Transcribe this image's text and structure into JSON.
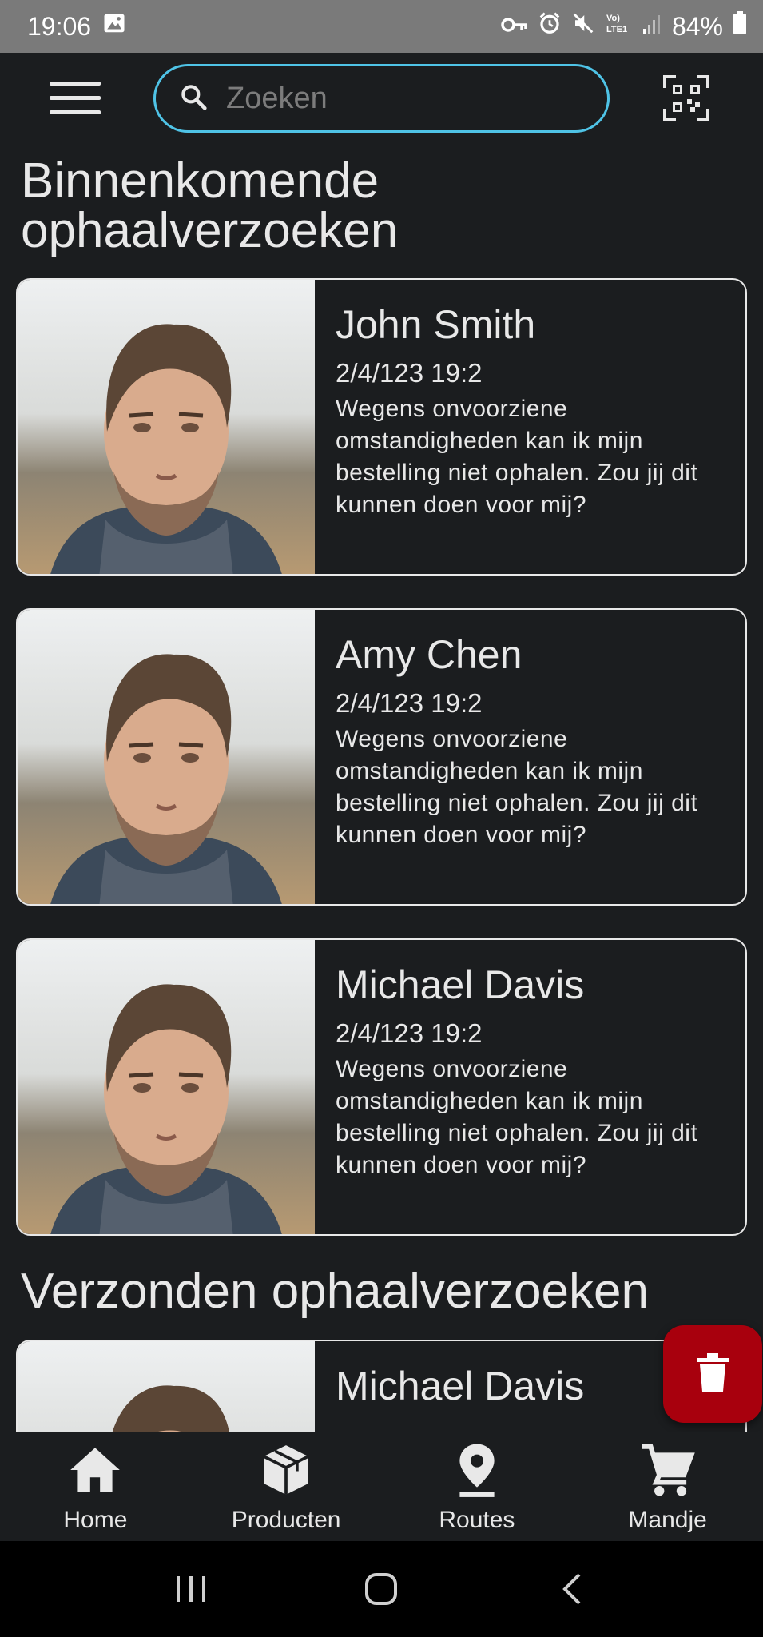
{
  "status_bar": {
    "time": "19:06",
    "battery": "84%",
    "icons": [
      "gallery-icon",
      "vpn-key-icon",
      "alarm-icon",
      "mute-icon",
      "volte-icon",
      "signal-icon",
      "battery-icon"
    ]
  },
  "app_bar": {
    "menu_icon": "hamburger-menu-icon",
    "search": {
      "placeholder": "Zoeken",
      "value": ""
    },
    "qr_icon": "qr-code-scan-icon",
    "accent_color": "#4fc3e6"
  },
  "sections": {
    "incoming_title": "Binnenkomende ophaalverzoeken",
    "sent_title": "Verzonden ophaalverzoeken"
  },
  "incoming_requests": [
    {
      "name": "John Smith",
      "date": "2/4/123 19:2",
      "message": "Wegens onvoorziene omstandigheden kan ik mijn bestelling niet ophalen. Zou jij dit kunnen doen voor mij?"
    },
    {
      "name": "Amy Chen",
      "date": "2/4/123 19:2",
      "message": "Wegens onvoorziene omstandigheden kan ik mijn bestelling niet ophalen. Zou jij dit kunnen doen voor mij?"
    },
    {
      "name": "Michael Davis",
      "date": "2/4/123 19:2",
      "message": "Wegens onvoorziene omstandigheden kan ik mijn bestelling niet ophalen. Zou jij dit kunnen doen voor mij?"
    }
  ],
  "sent_requests": [
    {
      "name": "Michael Davis"
    }
  ],
  "fab": {
    "icon": "trash-icon",
    "color": "#a8000d"
  },
  "bottom_nav": {
    "items": [
      {
        "label": "Home",
        "icon": "home-icon"
      },
      {
        "label": "Producten",
        "icon": "package-icon"
      },
      {
        "label": "Routes",
        "icon": "location-pin-icon"
      },
      {
        "label": "Mandje",
        "icon": "cart-icon"
      }
    ]
  },
  "system_nav": {
    "icons": [
      "recents-icon",
      "home-circle-icon",
      "back-icon"
    ]
  }
}
